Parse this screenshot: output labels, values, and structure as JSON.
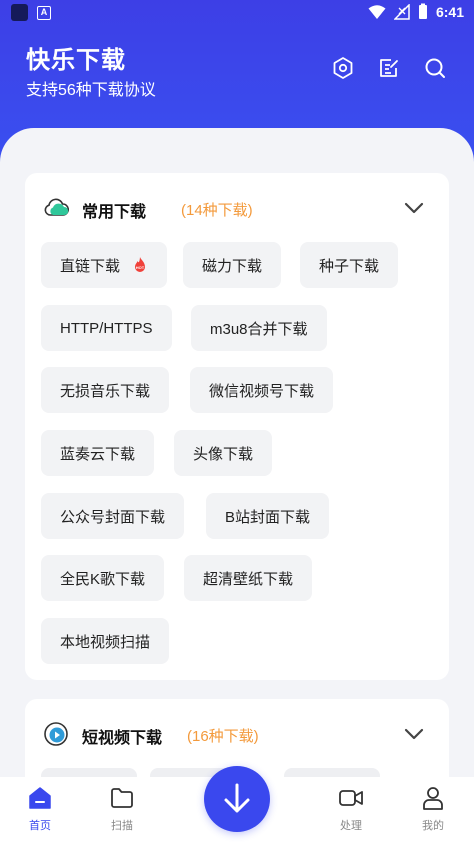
{
  "status_bar": {
    "time": "6:41",
    "icons": [
      "wifi-icon",
      "signal-icon",
      "battery-icon"
    ]
  },
  "header": {
    "title": "快乐下载",
    "subtitle": "支持56种下载协议",
    "icons": [
      "settings-icon",
      "notes-icon",
      "search-icon"
    ]
  },
  "colors": {
    "primary": "#3a48ee",
    "accent_orange": "#f39a3c",
    "background": "#f3f4f8"
  },
  "common_downloads": {
    "title": "常用下载",
    "count": "(14种下载)",
    "items": [
      "直链下载",
      "磁力下载",
      "种子下载",
      "HTTP/HTTPS",
      "m3u8合并下载",
      "无损音乐下载",
      "微信视频号下载",
      "蓝奏云下载",
      "头像下载",
      "公众号封面下载",
      "B站封面下载",
      "全民K歌下载",
      "超清壁纸下载",
      "本地视频扫描"
    ],
    "hot_badge": "HOT"
  },
  "short_video_downloads": {
    "title": "短视频下载",
    "count": "(16种下载)"
  },
  "bottom_nav": {
    "items": [
      {
        "label": "首页",
        "icon": "home-icon"
      },
      {
        "label": "扫描",
        "icon": "folder-icon"
      },
      {
        "label": "处理",
        "icon": "video-camera-icon"
      },
      {
        "label": "我的",
        "icon": "user-icon"
      }
    ],
    "fab_icon": "download-arrow-icon"
  }
}
